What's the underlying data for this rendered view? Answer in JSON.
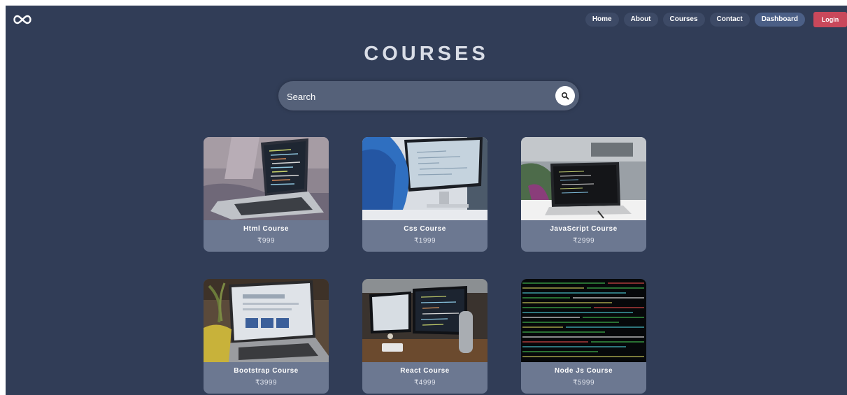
{
  "header": {
    "logo_icon": "infinity-icon",
    "nav": [
      {
        "label": "Home"
      },
      {
        "label": "About"
      },
      {
        "label": "Courses"
      },
      {
        "label": "Contact"
      },
      {
        "label": "Dashboard",
        "active": true
      }
    ],
    "login_label": "Login"
  },
  "main": {
    "title": "COURSES",
    "search": {
      "placeholder": "Search",
      "icon": "search-icon"
    },
    "courses": [
      {
        "title": "Html Course",
        "price": "₹999",
        "image": "laptop-code-photo"
      },
      {
        "title": "Css Course",
        "price": "₹1999",
        "image": "monitor-coder-photo"
      },
      {
        "title": "JavaScript Course",
        "price": "₹2999",
        "image": "laptop-desk-photo"
      },
      {
        "title": "Bootstrap Course",
        "price": "₹3999",
        "image": "laptop-plant-photo"
      },
      {
        "title": "React Course",
        "price": "₹4999",
        "image": "dual-monitor-photo"
      },
      {
        "title": "Node Js Course",
        "price": "₹5999",
        "image": "green-code-screen-photo"
      }
    ]
  },
  "colors": {
    "background": "#313d57",
    "card": "#6c7891",
    "login": "#c9485b",
    "search": "#556179"
  }
}
